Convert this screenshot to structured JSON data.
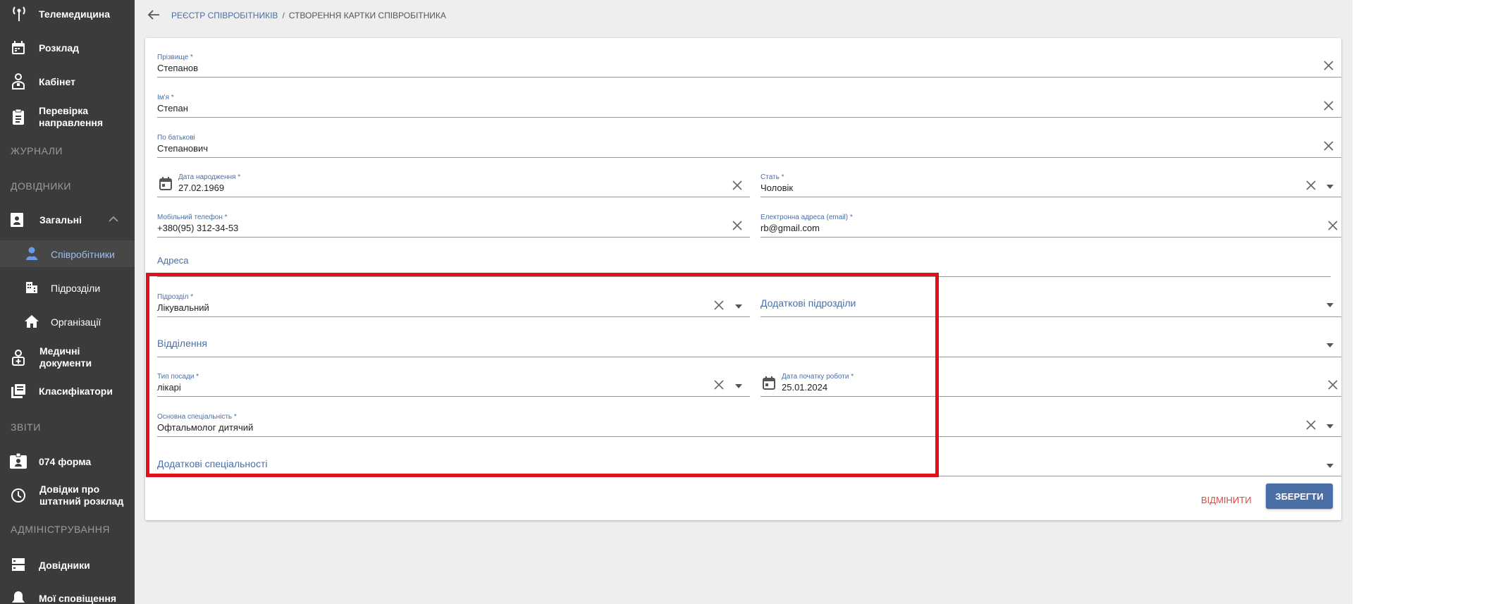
{
  "sidebar": {
    "items": {
      "telemedicine": "Телемедицина",
      "schedule": "Розклад",
      "cabinet": "Кабінет",
      "referral_check": [
        "Перевірка",
        "направлення"
      ],
      "general": "Загальні",
      "employees": "Співробітники",
      "subdivisions": "Підрозділи",
      "organizations": "Організації",
      "medical_docs": [
        "Медичні",
        "документи"
      ],
      "classifiers": "Класифікатори",
      "form074": "074 форма",
      "staff_certs": [
        "Довідки про",
        "штатний розклад"
      ],
      "references": "Довідники",
      "notifications": "Мої сповіщення"
    },
    "sections": {
      "journals": "ЖУРНАЛИ",
      "references": "ДОВІДНИКИ",
      "reports": "ЗВІТИ",
      "admin": "АДМІНІСТРУВАННЯ"
    }
  },
  "breadcrumb": {
    "parent": "Реєстр співробітників",
    "separator": "/",
    "current": "Створення картки співробітника"
  },
  "form": {
    "surname": {
      "label": "Прізвище *",
      "value": "Степанов"
    },
    "name": {
      "label": "Ім'я *",
      "value": "Степан"
    },
    "patronymic": {
      "label": "По батькові",
      "value": "Степанович"
    },
    "birth_date": {
      "label": "Дата народження *",
      "value": "27.02.1969"
    },
    "sex": {
      "label": "Стать *",
      "value": "Чоловік"
    },
    "phone": {
      "label": "Мобільний телефон *",
      "value": "+380(95) 312-34-53"
    },
    "email": {
      "label": "Електронна адреса (email) *",
      "value": "rb@gmail.com"
    },
    "address": {
      "placeholder": "Адреса"
    },
    "subdivision": {
      "label": "Підрозділ *",
      "value": "Лікувальний"
    },
    "extra_subdivisions": {
      "placeholder": "Додаткові підрозділи"
    },
    "department": {
      "placeholder": "Відділення"
    },
    "position_type": {
      "label": "Тип посади *",
      "value": "лікарі"
    },
    "work_start": {
      "label": "Дата початку роботи *",
      "value": "25.01.2024"
    },
    "main_specialty": {
      "label": "Основна спеціальність *",
      "value": "Офтальмолог дитячий"
    },
    "extra_specialties": {
      "placeholder": "Додаткові спеціальності"
    }
  },
  "actions": {
    "cancel": "Відмінити",
    "save": "Зберегти"
  },
  "colors": {
    "sidebar_bg": "#3b3b3b",
    "accent": "#4a6fa5",
    "cancel": "#d94b42",
    "highlight": "#e0101b"
  }
}
